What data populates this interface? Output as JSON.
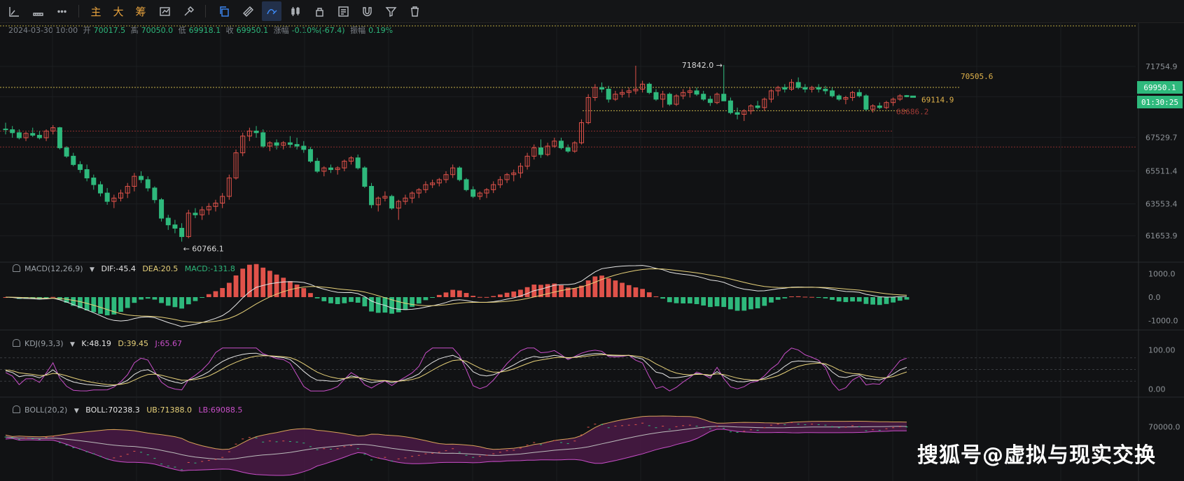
{
  "toolbar": {
    "labels_cn": [
      "主",
      "大",
      "筹"
    ]
  },
  "ohlc_bar": {
    "datetime": "2024-03-30 10:00",
    "open_label": "开",
    "open": "70017.5",
    "high_label": "高",
    "high": "70050.0",
    "low_label": "低",
    "low": "69918.1",
    "close_label": "收",
    "close": "69950.1",
    "change_label": "涨幅",
    "change": "-0.10%(-67.4)",
    "amp_label": "振幅",
    "amp": "0.19%"
  },
  "price_tags": {
    "last_price": "69950.1",
    "countdown": "01:30:25"
  },
  "annotations": {
    "high_marker": "71842.0 →",
    "low_marker": "← 60766.1",
    "line_upper": "70505.6",
    "line_mid": "69114.9",
    "line_red": "68686.2"
  },
  "indicators": {
    "macd": {
      "name": "MACD(12,26,9)",
      "dif": "DIF:-45.4",
      "dea": "DEA:20.5",
      "macd": "MACD:-131.8"
    },
    "kdj": {
      "name": "KDJ(9,3,3)",
      "k": "K:48.19",
      "d": "D:39.45",
      "j": "J:65.67"
    },
    "boll": {
      "name": "BOLL(20,2)",
      "boll": "BOLL:70238.3",
      "ub": "UB:71388.0",
      "lb": "LB:69088.5"
    }
  },
  "watermark": "搜狐号@虚拟与现实交换",
  "colors": {
    "up": "#e0524a",
    "down": "#2eb97c",
    "bg": "#111214",
    "grid": "#1c1e21",
    "dif": "#e6e6e6",
    "dea": "#e8d27a",
    "kdj_j": "#c94fc9",
    "boll_fill": "#4a1a45"
  },
  "chart_data": [
    {
      "type": "candlestick",
      "title": "",
      "ylim": [
        60700,
        72800
      ],
      "yticks": [
        "71754.9",
        "69950.1",
        "67529.7",
        "65511.4",
        "63553.4",
        "61653.9"
      ],
      "ohlc": [
        [
          68020,
          68400,
          67700,
          67980
        ],
        [
          67980,
          68200,
          67500,
          67800
        ],
        [
          67800,
          68000,
          67400,
          67500
        ],
        [
          67500,
          67850,
          67300,
          67760
        ],
        [
          67760,
          68100,
          67550,
          67650
        ],
        [
          67650,
          67900,
          67400,
          67500
        ],
        [
          67500,
          68000,
          67300,
          67900
        ],
        [
          67900,
          68250,
          67700,
          68100
        ],
        [
          68100,
          68150,
          66800,
          66900
        ],
        [
          66900,
          67000,
          66300,
          66400
        ],
        [
          66400,
          66600,
          65800,
          65900
        ],
        [
          65900,
          66100,
          65400,
          65600
        ],
        [
          65600,
          65900,
          64900,
          65100
        ],
        [
          65100,
          65300,
          64400,
          64700
        ],
        [
          64700,
          64900,
          64000,
          64200
        ],
        [
          64200,
          64500,
          63500,
          63700
        ],
        [
          63700,
          64100,
          63300,
          63900
        ],
        [
          63900,
          64400,
          63700,
          64200
        ],
        [
          64200,
          64800,
          63900,
          64600
        ],
        [
          64600,
          65400,
          64300,
          65200
        ],
        [
          65200,
          65500,
          64800,
          65000
        ],
        [
          65000,
          65200,
          64300,
          64500
        ],
        [
          64500,
          64600,
          63600,
          63800
        ],
        [
          63800,
          63900,
          62500,
          62700
        ],
        [
          62700,
          62900,
          62000,
          62300
        ],
        [
          62300,
          62600,
          61800,
          62100
        ],
        [
          62100,
          62400,
          61300,
          61600
        ],
        [
          61600,
          63200,
          61500,
          63000
        ],
        [
          63000,
          63300,
          62700,
          62900
        ],
        [
          62900,
          63400,
          62600,
          63200
        ],
        [
          63200,
          63600,
          62900,
          63400
        ],
        [
          63400,
          63800,
          63100,
          63600
        ],
        [
          63600,
          64200,
          63300,
          64000
        ],
        [
          64000,
          65300,
          63800,
          65100
        ],
        [
          65100,
          66800,
          65000,
          66600
        ],
        [
          66600,
          67800,
          66400,
          67600
        ],
        [
          67600,
          68100,
          67300,
          67900
        ],
        [
          67900,
          68200,
          67500,
          67800
        ],
        [
          67800,
          68000,
          66900,
          67000
        ],
        [
          67000,
          67300,
          66700,
          67200
        ],
        [
          67200,
          67400,
          66800,
          67050
        ],
        [
          67050,
          67300,
          66800,
          67200
        ],
        [
          67200,
          67600,
          66900,
          67100
        ],
        [
          67100,
          67500,
          66800,
          67000
        ],
        [
          67000,
          67300,
          66600,
          66800
        ],
        [
          66800,
          66950,
          66000,
          66100
        ],
        [
          66100,
          66300,
          65400,
          65500
        ],
        [
          65500,
          65800,
          65200,
          65700
        ],
        [
          65700,
          65900,
          65400,
          65600
        ],
        [
          65600,
          65800,
          65300,
          65700
        ],
        [
          65700,
          66200,
          65500,
          66100
        ],
        [
          66100,
          66400,
          65900,
          66300
        ],
        [
          66300,
          66500,
          65600,
          65700
        ],
        [
          65700,
          65800,
          64500,
          64600
        ],
        [
          64600,
          64800,
          63300,
          63500
        ],
        [
          63500,
          64000,
          63100,
          63900
        ],
        [
          63900,
          64300,
          63700,
          64000
        ],
        [
          64000,
          64100,
          63200,
          63300
        ],
        [
          63300,
          63800,
          62600,
          63700
        ],
        [
          63700,
          64100,
          63500,
          63900
        ],
        [
          63900,
          64300,
          63600,
          64200
        ],
        [
          64200,
          64500,
          63900,
          64400
        ],
        [
          64400,
          64900,
          64200,
          64700
        ],
        [
          64700,
          65000,
          64500,
          64800
        ],
        [
          64800,
          65100,
          64600,
          65000
        ],
        [
          65000,
          65500,
          64800,
          65300
        ],
        [
          65300,
          65900,
          65100,
          65700
        ],
        [
          65700,
          65800,
          64900,
          65000
        ],
        [
          65000,
          65100,
          64300,
          64400
        ],
        [
          64400,
          64600,
          63900,
          64000
        ],
        [
          64000,
          64300,
          63800,
          64200
        ],
        [
          64200,
          64500,
          63900,
          64400
        ],
        [
          64400,
          64900,
          64200,
          64700
        ],
        [
          64700,
          65200,
          64500,
          65000
        ],
        [
          65000,
          65400,
          64800,
          65300
        ],
        [
          65300,
          65600,
          64900,
          65400
        ],
        [
          65400,
          66000,
          65100,
          65800
        ],
        [
          65800,
          66600,
          65600,
          66400
        ],
        [
          66400,
          67100,
          66200,
          66900
        ],
        [
          66900,
          67400,
          66300,
          66500
        ],
        [
          66500,
          67200,
          66400,
          67000
        ],
        [
          67000,
          67500,
          66900,
          67300
        ],
        [
          67300,
          67500,
          66800,
          66900
        ],
        [
          66900,
          67100,
          66600,
          66700
        ],
        [
          66700,
          67300,
          66600,
          67200
        ],
        [
          67200,
          68600,
          67100,
          68400
        ],
        [
          68400,
          70100,
          68300,
          69900
        ],
        [
          69900,
          70700,
          69700,
          70500
        ],
        [
          70500,
          70800,
          70200,
          70400
        ],
        [
          70400,
          70600,
          69600,
          69800
        ],
        [
          69800,
          70300,
          69700,
          70100
        ],
        [
          70100,
          70400,
          69900,
          70200
        ],
        [
          70200,
          70500,
          69900,
          70300
        ],
        [
          70300,
          71800,
          70100,
          70400
        ],
        [
          70400,
          70900,
          70200,
          70700
        ],
        [
          70700,
          70800,
          70100,
          70200
        ],
        [
          70200,
          70400,
          69700,
          69800
        ],
        [
          69800,
          70300,
          69300,
          70100
        ],
        [
          70100,
          70200,
          69400,
          69500
        ],
        [
          69500,
          70100,
          69400,
          70000
        ],
        [
          70000,
          70400,
          69800,
          70200
        ],
        [
          70200,
          70500,
          69900,
          70300
        ],
        [
          70300,
          70500,
          70000,
          70100
        ],
        [
          70100,
          70300,
          69700,
          69800
        ],
        [
          69800,
          70000,
          69400,
          69600
        ],
        [
          69600,
          70200,
          69500,
          70100
        ],
        [
          70100,
          71842,
          70000,
          69700
        ],
        [
          69700,
          69900,
          68900,
          69000
        ],
        [
          69000,
          69300,
          68600,
          68900
        ],
        [
          68900,
          69200,
          68500,
          69100
        ],
        [
          69100,
          69500,
          68900,
          69400
        ],
        [
          69400,
          69700,
          69200,
          69300
        ],
        [
          69300,
          69900,
          69100,
          69800
        ],
        [
          69800,
          70400,
          69600,
          70300
        ],
        [
          70300,
          70600,
          70000,
          70500
        ],
        [
          70500,
          70700,
          70200,
          70400
        ],
        [
          70400,
          71000,
          70300,
          70800
        ],
        [
          70800,
          71100,
          70400,
          70500
        ],
        [
          70500,
          70700,
          70200,
          70400
        ],
        [
          70400,
          70600,
          70200,
          70500
        ],
        [
          70500,
          70700,
          70200,
          70400
        ],
        [
          70400,
          70600,
          70100,
          70300
        ],
        [
          70300,
          70500,
          69900,
          70000
        ],
        [
          70000,
          70100,
          69700,
          69800
        ],
        [
          69800,
          70000,
          69500,
          69900
        ],
        [
          69900,
          70300,
          69700,
          70200
        ],
        [
          70200,
          70400,
          69900,
          70000
        ],
        [
          70000,
          70100,
          69100,
          69200
        ],
        [
          69200,
          69500,
          69000,
          69400
        ],
        [
          69400,
          69600,
          69200,
          69300
        ],
        [
          69300,
          69700,
          69200,
          69600
        ],
        [
          69600,
          69900,
          69400,
          69800
        ],
        [
          69800,
          70100,
          69700,
          70000
        ],
        [
          70017.5,
          70050,
          69918.1,
          69950.1
        ]
      ],
      "hlines": [
        70505.6,
        69114.9,
        68686.2,
        67900,
        66950
      ]
    },
    {
      "type": "bar",
      "title": "MACD(12,26,9)",
      "ylim": [
        -1200,
        1200
      ],
      "yticks": [
        "1000.0",
        "0.0",
        "-1000.0"
      ]
    },
    {
      "type": "line",
      "title": "KDJ(9,3,3)",
      "ylim": [
        -10,
        110
      ],
      "yticks": [
        "100.00",
        "0.00"
      ]
    },
    {
      "type": "area",
      "title": "BOLL(20,2)",
      "yticks": [
        "70000.0"
      ]
    }
  ]
}
